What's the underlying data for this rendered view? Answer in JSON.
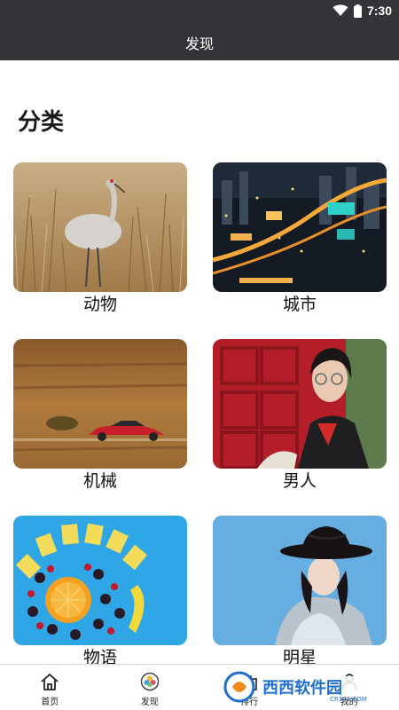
{
  "status_bar": {
    "time": "7:30"
  },
  "app_bar": {
    "title": "发现"
  },
  "section": {
    "title": "分类"
  },
  "categories": [
    {
      "label": "动物",
      "icon": "crane-photo"
    },
    {
      "label": "城市",
      "icon": "city-night-photo"
    },
    {
      "label": "机械",
      "icon": "red-car-photo"
    },
    {
      "label": "男人",
      "icon": "man-portrait-photo"
    },
    {
      "label": "物语",
      "icon": "fruit-photo"
    },
    {
      "label": "明星",
      "icon": "woman-hat-photo"
    }
  ],
  "bottom_nav": [
    {
      "label": "首页",
      "icon": "home-icon"
    },
    {
      "label": "发现",
      "icon": "discover-icon"
    },
    {
      "label": "排行",
      "icon": "ranking-icon"
    },
    {
      "label": "我的",
      "icon": "profile-icon"
    }
  ],
  "watermark": {
    "text": "西西软件园",
    "subtext": "CR173.COM"
  }
}
